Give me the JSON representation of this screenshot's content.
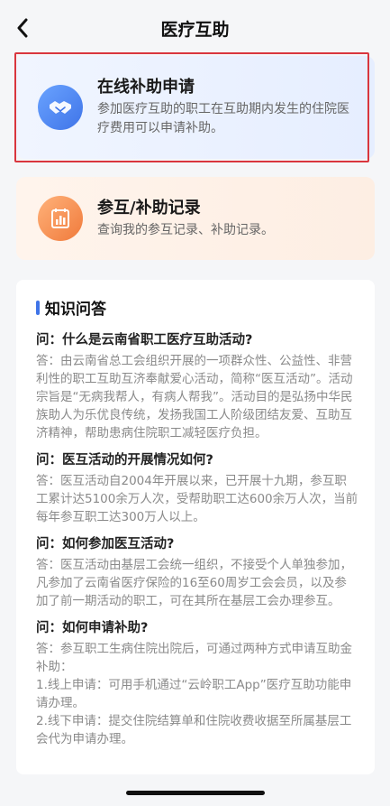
{
  "header": {
    "title": "医疗互助"
  },
  "cards": [
    {
      "title": "在线补助申请",
      "desc": "参加医疗互助的职工在互助期内发生的住院医疗费用可以申请补助。",
      "icon": "handshake-icon"
    },
    {
      "title": "参互/补助记录",
      "desc": "查询我的参互记录、补助记录。",
      "icon": "bar-chart-icon"
    }
  ],
  "faq": {
    "title": "知识问答",
    "items": [
      {
        "q": "问：什么是云南省职工医疗互助活动?",
        "a": "答：由云南省总工会组织开展的一项群众性、公益性、非营利性的职工互助互济奉献爱心活动，简称“医互活动”。活动宗旨是“无病我帮人，有病人帮我”。活动目的是弘扬中华民族助人为乐优良传统，发扬我国工人阶级团结友爱、互助互济精神，帮助患病住院职工减轻医疗负担。"
      },
      {
        "q": "问：医互活动的开展情况如何?",
        "a": "答：医互活动自2004年开展以来，已开展十九期，参互职工累计达5100余万人次，受帮助职工达600余万人次，当前每年参互职工达300万人以上。"
      },
      {
        "q": "问：如何参加医互活动?",
        "a": "答：医互活动由基层工会统一组织，不接受个人单独参加，凡参加了云南省医疗保险的16至60周岁工会会员，以及参加了前一期活动的职工，可在其所在基层工会办理参互。"
      },
      {
        "q": "问：如何申请补助?",
        "a": "答：参互职工生病住院出院后，可通过两种方式申请互助金补助：",
        "a2": "1.线上申请：可用手机通过“云岭职工App”医疗互助功能申请办理。",
        "a3": "2.线下申请：提交住院结算单和住院收费收据至所属基层工会代为申请办理。"
      }
    ]
  },
  "colors": {
    "accent_blue": "#3f74e8",
    "accent_orange": "#f07a3b",
    "highlight_red": "#d9363e"
  }
}
